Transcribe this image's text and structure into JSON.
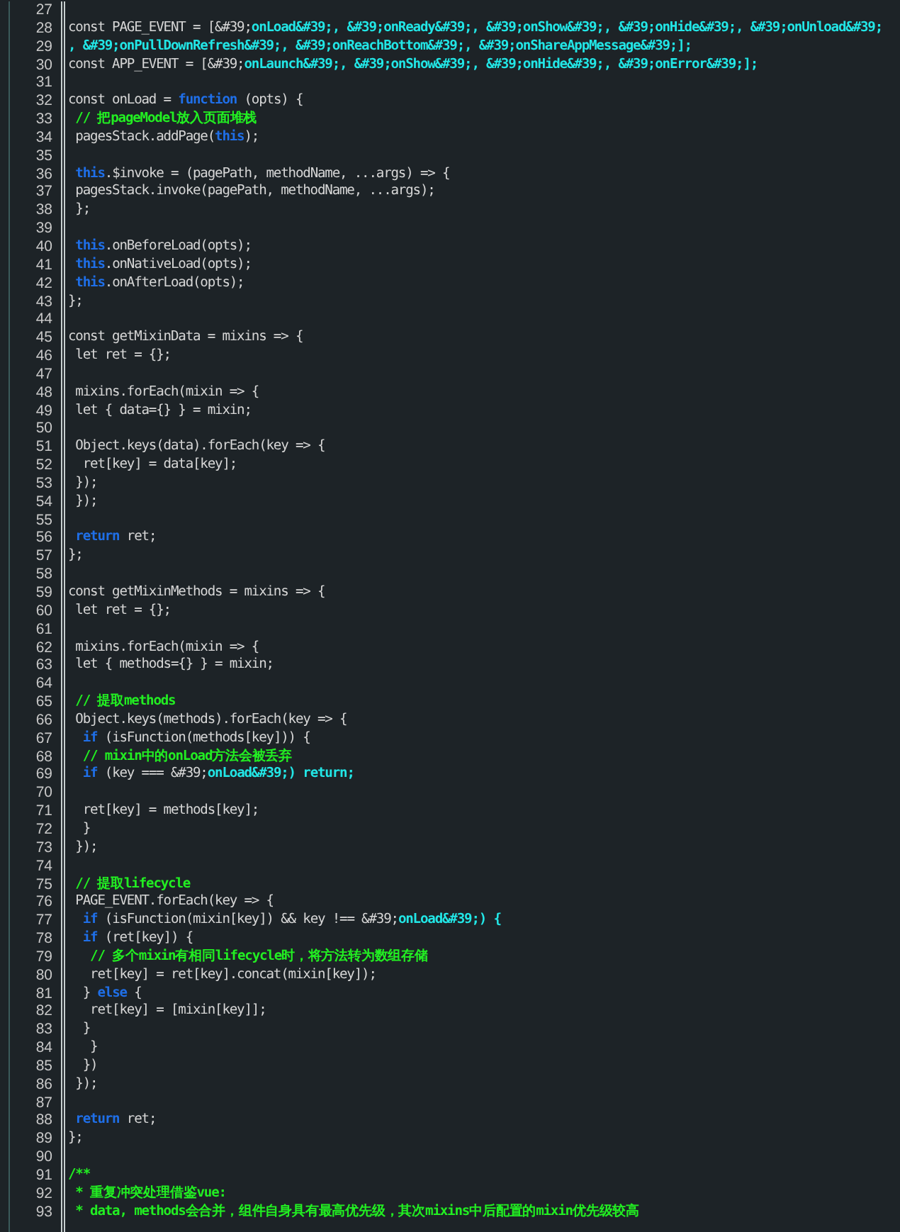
{
  "editor": {
    "lines": [
      {
        "number": "27"
      },
      {
        "number": "28",
        "tokens": [
          {
            "kind": "plain",
            "text": "const PAGE_EVENT = [&#39;"
          },
          {
            "kind": "string",
            "text": "onLoad&#39;, &#39;onReady&#39;, &#39;onShow&#39;, &#39;onHide&#39;, &#39;onUnload&#39;"
          }
        ]
      },
      {
        "number": "29",
        "tokens": [
          {
            "kind": "string",
            "text": ", &#39;onPullDownRefresh&#39;, &#39;onReachBottom&#39;, &#39;onShareAppMessage&#39;];"
          }
        ]
      },
      {
        "number": "30",
        "tokens": [
          {
            "kind": "plain",
            "text": "const APP_EVENT = [&#39;"
          },
          {
            "kind": "string",
            "text": "onLaunch&#39;, &#39;onShow&#39;, &#39;onHide&#39;, &#39;onError&#39;];"
          }
        ]
      },
      {
        "number": "31"
      },
      {
        "number": "32",
        "tokens": [
          {
            "kind": "plain",
            "text": "const onLoad = "
          },
          {
            "kind": "keyword",
            "text": "function"
          },
          {
            "kind": "plain",
            "text": " (opts) {"
          }
        ]
      },
      {
        "number": "33",
        "tokens": [
          {
            "kind": "comment",
            "text": " // 把pageModel放入页面堆栈"
          }
        ]
      },
      {
        "number": "34",
        "tokens": [
          {
            "kind": "plain",
            "text": " pagesStack.addPage("
          },
          {
            "kind": "keyword",
            "text": "this"
          },
          {
            "kind": "plain",
            "text": ");"
          }
        ]
      },
      {
        "number": "35"
      },
      {
        "number": "36",
        "tokens": [
          {
            "kind": "keyword",
            "text": " this"
          },
          {
            "kind": "plain",
            "text": ".$invoke = (pagePath, methodName, ...args) => {"
          }
        ]
      },
      {
        "number": "37",
        "tokens": [
          {
            "kind": "plain",
            "text": " pagesStack.invoke(pagePath, methodName, ...args);"
          }
        ]
      },
      {
        "number": "38",
        "tokens": [
          {
            "kind": "plain",
            "text": " };"
          }
        ]
      },
      {
        "number": "39"
      },
      {
        "number": "40",
        "tokens": [
          {
            "kind": "keyword",
            "text": " this"
          },
          {
            "kind": "plain",
            "text": ".onBeforeLoad(opts);"
          }
        ]
      },
      {
        "number": "41",
        "tokens": [
          {
            "kind": "keyword",
            "text": " this"
          },
          {
            "kind": "plain",
            "text": ".onNativeLoad(opts);"
          }
        ]
      },
      {
        "number": "42",
        "tokens": [
          {
            "kind": "keyword",
            "text": " this"
          },
          {
            "kind": "plain",
            "text": ".onAfterLoad(opts);"
          }
        ]
      },
      {
        "number": "43",
        "tokens": [
          {
            "kind": "plain",
            "text": "};"
          }
        ]
      },
      {
        "number": "44"
      },
      {
        "number": "45",
        "tokens": [
          {
            "kind": "plain",
            "text": "const getMixinData = mixins => {"
          }
        ]
      },
      {
        "number": "46",
        "tokens": [
          {
            "kind": "plain",
            "text": " let ret = {};"
          }
        ]
      },
      {
        "number": "47"
      },
      {
        "number": "48",
        "tokens": [
          {
            "kind": "plain",
            "text": " mixins.forEach(mixin => {"
          }
        ]
      },
      {
        "number": "49",
        "tokens": [
          {
            "kind": "plain",
            "text": " let { data={} } = mixin;"
          }
        ]
      },
      {
        "number": "50"
      },
      {
        "number": "51",
        "tokens": [
          {
            "kind": "plain",
            "text": " Object.keys(data).forEach(key => {"
          }
        ]
      },
      {
        "number": "52",
        "tokens": [
          {
            "kind": "plain",
            "text": "  ret[key] = data[key];"
          }
        ]
      },
      {
        "number": "53",
        "tokens": [
          {
            "kind": "plain",
            "text": " });"
          }
        ]
      },
      {
        "number": "54",
        "tokens": [
          {
            "kind": "plain",
            "text": " });"
          }
        ]
      },
      {
        "number": "55"
      },
      {
        "number": "56",
        "tokens": [
          {
            "kind": "keyword",
            "text": " return"
          },
          {
            "kind": "plain",
            "text": " ret;"
          }
        ]
      },
      {
        "number": "57",
        "tokens": [
          {
            "kind": "plain",
            "text": "};"
          }
        ]
      },
      {
        "number": "58"
      },
      {
        "number": "59",
        "tokens": [
          {
            "kind": "plain",
            "text": "const getMixinMethods = mixins => {"
          }
        ]
      },
      {
        "number": "60",
        "tokens": [
          {
            "kind": "plain",
            "text": " let ret = {};"
          }
        ]
      },
      {
        "number": "61"
      },
      {
        "number": "62",
        "tokens": [
          {
            "kind": "plain",
            "text": " mixins.forEach(mixin => {"
          }
        ]
      },
      {
        "number": "63",
        "tokens": [
          {
            "kind": "plain",
            "text": " let { methods={} } = mixin;"
          }
        ]
      },
      {
        "number": "64"
      },
      {
        "number": "65",
        "tokens": [
          {
            "kind": "comment",
            "text": " // 提取methods"
          }
        ]
      },
      {
        "number": "66",
        "tokens": [
          {
            "kind": "plain",
            "text": " Object.keys(methods).forEach(key => {"
          }
        ]
      },
      {
        "number": "67",
        "tokens": [
          {
            "kind": "keyword",
            "text": "  if"
          },
          {
            "kind": "plain",
            "text": " (isFunction(methods[key])) {"
          }
        ]
      },
      {
        "number": "68",
        "tokens": [
          {
            "kind": "comment",
            "text": "  // mixin中的onLoad方法会被丢弃"
          }
        ]
      },
      {
        "number": "69",
        "tokens": [
          {
            "kind": "keyword",
            "text": "  if"
          },
          {
            "kind": "plain",
            "text": " (key === &#39;"
          },
          {
            "kind": "string",
            "text": "onLoad&#39;) return;"
          }
        ]
      },
      {
        "number": "70"
      },
      {
        "number": "71",
        "tokens": [
          {
            "kind": "plain",
            "text": "  ret[key] = methods[key];"
          }
        ]
      },
      {
        "number": "72",
        "tokens": [
          {
            "kind": "plain",
            "text": "  }"
          }
        ]
      },
      {
        "number": "73",
        "tokens": [
          {
            "kind": "plain",
            "text": " });"
          }
        ]
      },
      {
        "number": "74"
      },
      {
        "number": "75",
        "tokens": [
          {
            "kind": "comment",
            "text": " // 提取lifecycle"
          }
        ]
      },
      {
        "number": "76",
        "tokens": [
          {
            "kind": "plain",
            "text": " PAGE_EVENT.forEach(key => {"
          }
        ]
      },
      {
        "number": "77",
        "tokens": [
          {
            "kind": "keyword",
            "text": "  if"
          },
          {
            "kind": "plain",
            "text": " (isFunction(mixin[key]) && key !== &#39;"
          },
          {
            "kind": "string",
            "text": "onLoad&#39;) {"
          }
        ]
      },
      {
        "number": "78",
        "tokens": [
          {
            "kind": "keyword",
            "text": "  if"
          },
          {
            "kind": "plain",
            "text": " (ret[key]) {"
          }
        ]
      },
      {
        "number": "79",
        "tokens": [
          {
            "kind": "comment",
            "text": "   // 多个mixin有相同lifecycle时，将方法转为数组存储"
          }
        ]
      },
      {
        "number": "80",
        "tokens": [
          {
            "kind": "plain",
            "text": "   ret[key] = ret[key].concat(mixin[key]);"
          }
        ]
      },
      {
        "number": "81",
        "tokens": [
          {
            "kind": "plain",
            "text": "  } "
          },
          {
            "kind": "keyword",
            "text": "else"
          },
          {
            "kind": "plain",
            "text": " {"
          }
        ]
      },
      {
        "number": "82",
        "tokens": [
          {
            "kind": "plain",
            "text": "   ret[key] = [mixin[key]];"
          }
        ]
      },
      {
        "number": "83",
        "tokens": [
          {
            "kind": "plain",
            "text": "  }"
          }
        ]
      },
      {
        "number": "84",
        "tokens": [
          {
            "kind": "plain",
            "text": "   }"
          }
        ]
      },
      {
        "number": "85",
        "tokens": [
          {
            "kind": "plain",
            "text": "  })"
          }
        ]
      },
      {
        "number": "86",
        "tokens": [
          {
            "kind": "plain",
            "text": " });"
          }
        ]
      },
      {
        "number": "87"
      },
      {
        "number": "88",
        "tokens": [
          {
            "kind": "keyword",
            "text": " return"
          },
          {
            "kind": "plain",
            "text": " ret;"
          }
        ]
      },
      {
        "number": "89",
        "tokens": [
          {
            "kind": "plain",
            "text": "};"
          }
        ]
      },
      {
        "number": "90"
      },
      {
        "number": "91",
        "tokens": [
          {
            "kind": "comment",
            "text": "/**"
          }
        ]
      },
      {
        "number": "92",
        "tokens": [
          {
            "kind": "comment",
            "text": " * 重复冲突处理借鉴vue:"
          }
        ]
      },
      {
        "number": "93",
        "tokens": [
          {
            "kind": "comment",
            "text": " * data, methods会合并，组件自身具有最高优先级，其次mixins中后配置的mixin优先级较高"
          }
        ]
      }
    ]
  }
}
